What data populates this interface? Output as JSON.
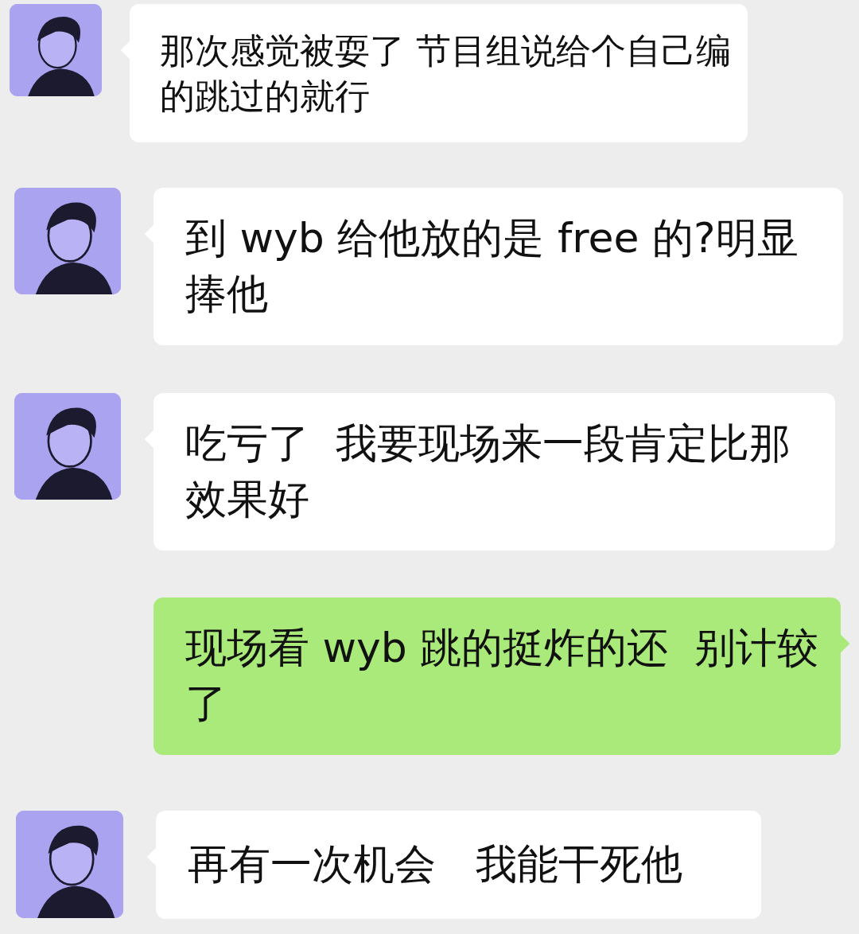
{
  "messages": [
    {
      "kind": "incoming",
      "text": "那次感觉被耍了 节目组说给个自己编的跳过的就行"
    },
    {
      "kind": "incoming",
      "text": "到 wyb 给他放的是 free 的?明显捧他"
    },
    {
      "kind": "incoming",
      "text": "吃亏了  我要现场来一段肯定比那效果好"
    },
    {
      "kind": "outgoing",
      "text": "现场看 wyb 跳的挺炸的还  别计较了"
    },
    {
      "kind": "incoming",
      "text": "再有一次机会   我能干死他"
    }
  ]
}
